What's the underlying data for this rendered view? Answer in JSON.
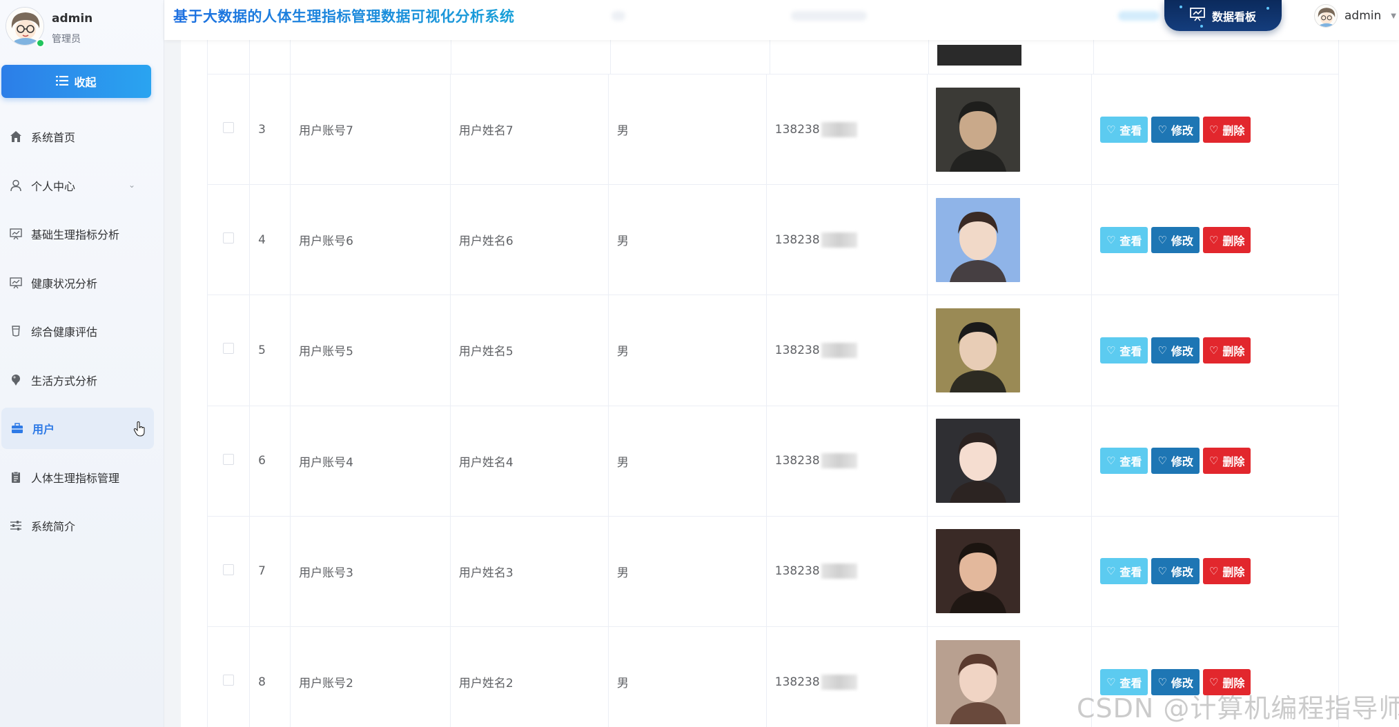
{
  "app": {
    "title": "基于大数据的人体生理指标管理数据可视化分析系统",
    "dashboard_button": "数据看板"
  },
  "profile": {
    "name": "admin",
    "role": "管理员"
  },
  "header_user": {
    "name": "admin"
  },
  "sidebar": {
    "collapse_label": "收起",
    "items": [
      {
        "label": "系统首页",
        "icon": "home-icon"
      },
      {
        "label": "个人中心",
        "icon": "user-icon"
      },
      {
        "label": "基础生理指标分析",
        "icon": "chart-board-icon"
      },
      {
        "label": "健康状况分析",
        "icon": "chart-board-icon"
      },
      {
        "label": "综合健康评估",
        "icon": "cup-icon"
      },
      {
        "label": "生活方式分析",
        "icon": "pin-icon"
      },
      {
        "label": "用户",
        "icon": "briefcase-icon"
      },
      {
        "label": "人体生理指标管理",
        "icon": "clipboard-icon"
      },
      {
        "label": "系统简介",
        "icon": "sliders-icon"
      }
    ],
    "active_index": 6
  },
  "table": {
    "rows": [
      {
        "index": "3",
        "account": "用户账号7",
        "name": "用户姓名7",
        "gender": "男",
        "phone": "138238"
      },
      {
        "index": "4",
        "account": "用户账号6",
        "name": "用户姓名6",
        "gender": "男",
        "phone": "138238"
      },
      {
        "index": "5",
        "account": "用户账号5",
        "name": "用户姓名5",
        "gender": "男",
        "phone": "138238"
      },
      {
        "index": "6",
        "account": "用户账号4",
        "name": "用户姓名4",
        "gender": "男",
        "phone": "138238"
      },
      {
        "index": "7",
        "account": "用户账号3",
        "name": "用户姓名3",
        "gender": "男",
        "phone": "138238"
      },
      {
        "index": "8",
        "account": "用户账号2",
        "name": "用户姓名2",
        "gender": "男",
        "phone": "138238"
      }
    ],
    "actions": {
      "view": "查看",
      "edit": "修改",
      "delete": "删除"
    }
  },
  "watermark": "CSDN @计算机编程指导师",
  "colors": {
    "primary": "#2e7ae6",
    "view": "#5ccbf0",
    "edit": "#1e76b4",
    "delete": "#e2272d",
    "dashboard": "#0b2a5c"
  }
}
